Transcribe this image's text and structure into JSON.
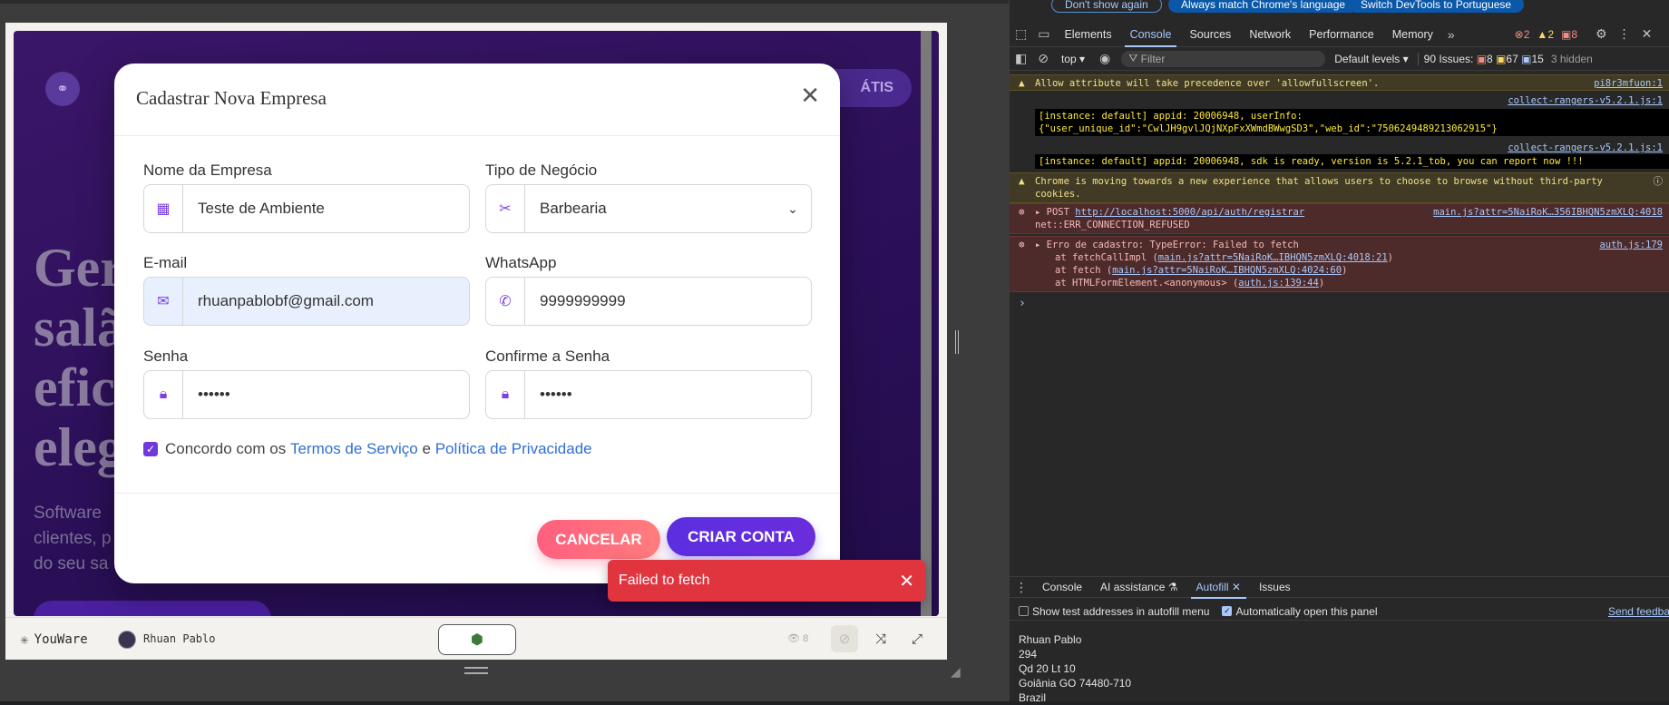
{
  "preview": {
    "hero_title_lines": [
      "Ger",
      "salã",
      "efic",
      "eleg"
    ],
    "hero_sub_lines": [
      "Software",
      "clientes, p",
      "do seu sa"
    ],
    "hero_btn": "ÁTIS",
    "bottom": {
      "brand": "YouWare",
      "user": "Rhuan Pablo",
      "views": "8"
    }
  },
  "modal": {
    "title": "Cadastrar Nova Empresa",
    "fields": {
      "company_label": "Nome da Empresa",
      "company_value": "Teste de Ambiente",
      "type_label": "Tipo de Negócio",
      "type_value": "Barbearia",
      "email_label": "E-mail",
      "email_value": "rhuanpablobf@gmail.com",
      "whatsapp_label": "WhatsApp",
      "whatsapp_value": "9999999999",
      "password_label": "Senha",
      "password_value": "••••••",
      "confirm_label": "Confirme a Senha",
      "confirm_value": "••••••"
    },
    "agree": {
      "prefix": "Concordo com os",
      "terms": "Termos de Serviço",
      "and": "e",
      "privacy": "Política de Privacidade"
    },
    "cancel_label": "CANCELAR",
    "create_label": "CRIAR CONTA"
  },
  "toast": {
    "message": "Failed to fetch"
  },
  "devtools": {
    "infobar": {
      "dont_show": "Don't show again",
      "match_lang": "Always match Chrome's language",
      "switch_lang": "Switch DevTools to Portuguese"
    },
    "tabs": [
      "Elements",
      "Console",
      "Sources",
      "Network",
      "Performance",
      "Memory"
    ],
    "counts": {
      "errors": "2",
      "warnings": "2",
      "issues": "8"
    },
    "toolbar": {
      "context": "top",
      "filter_placeholder": "Filter",
      "levels": "Default levels",
      "issues_label": "90 Issues:",
      "i_err": "8",
      "i_warn": "67",
      "i_info": "15",
      "hidden": "3 hidden"
    },
    "console": {
      "m1_text": "Allow attribute will take precedence over 'allowfullscreen'.",
      "m1_src": "pi8r3mfuon:1",
      "m2_src": "collect-rangers-v5.2.1.js:1",
      "m2_line1": "[instance: default] appid: 20006948, userInfo:",
      "m2_line2": "{\"user_unique_id\":\"CwlJH9gvlJQjNXpFxXWmdBWwgSD3\",\"web_id\":\"7506249489213062915\"}",
      "m3_src": "collect-rangers-v5.2.1.js:1",
      "m3_line": "[instance: default] appid: 20006948, sdk is ready, version is 5.2.1_tob, you can report now !!!",
      "m4_line1": "Chrome is moving towards a new experience that allows users to choose to browse without third-party",
      "m4_line2": "cookies.",
      "m5_method": "POST",
      "m5_url": "http://localhost:5000/api/auth/registrar",
      "m5_src": "main.js?attr=5NaiRoK…356IBHQN5zmXLQ:4018",
      "m5_err": "net::ERR_CONNECTION_REFUSED",
      "m6_line1": "Erro de cadastro: TypeError: Failed to fetch",
      "m6_src": "auth.js:179",
      "m6_at1_pre": "at fetchCallImpl (",
      "m6_at1_link": "main.js?attr=5NaiRoK…IBHQN5zmXLQ:4018:21",
      "m6_at2_pre": "at fetch (",
      "m6_at2_link": "main.js?attr=5NaiRoK…IBHQN5zmXLQ:4024:60",
      "m6_at3_pre": "at HTMLFormElement.<anonymous> (",
      "m6_at3_link": "auth.js:139:44",
      "close_paren": ")"
    },
    "drawer": {
      "tabs": [
        "Console",
        "AI assistance",
        "Autofill",
        "Issues"
      ],
      "show_test": "Show test addresses in autofill menu",
      "auto_open": "Automatically open this panel",
      "send_feedback": "Send feedba",
      "address_lines": [
        "Rhuan Pablo",
        "294",
        "Qd 20 Lt 10",
        "Goiânia GO 74480-710",
        "Brazil"
      ]
    }
  }
}
